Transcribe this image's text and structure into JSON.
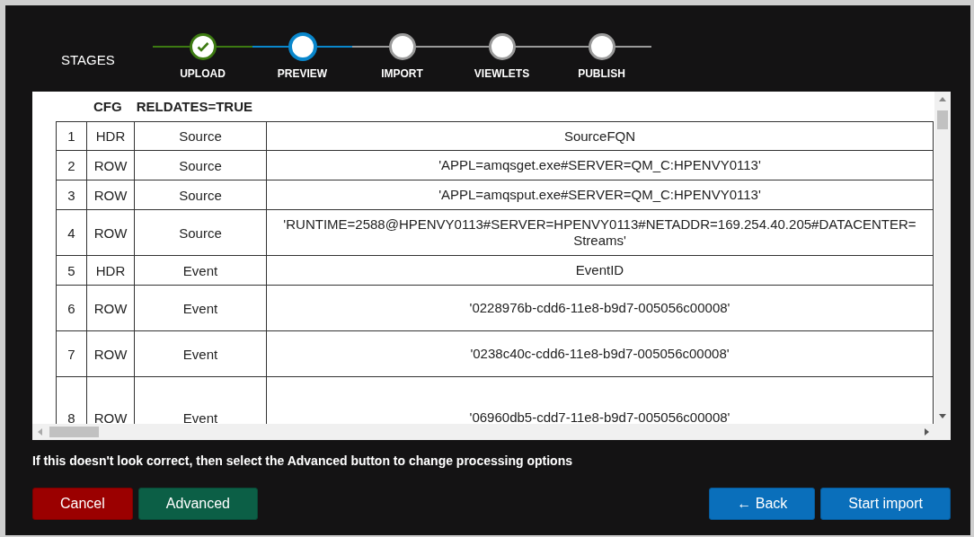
{
  "stages_label": "STAGES",
  "stages": [
    {
      "label": "UPLOAD",
      "completed": true,
      "selected": false
    },
    {
      "label": "PREVIEW",
      "completed": false,
      "selected": true
    },
    {
      "label": "IMPORT",
      "completed": false,
      "selected": false
    },
    {
      "label": "VIEWLETS",
      "completed": false,
      "selected": false
    },
    {
      "label": "PUBLISH",
      "completed": false,
      "selected": false
    }
  ],
  "config": {
    "key": "CFG",
    "value": "RELDATES=TRUE"
  },
  "table": {
    "rows": [
      {
        "cells": [
          "1",
          "HDR",
          "Source",
          [
            "SourceFQN"
          ]
        ]
      },
      {
        "cells": [
          "2",
          "ROW",
          "Source",
          [
            "'APPL=amqsget.exe#SERVER=QM_C:HPENVY0113'"
          ]
        ]
      },
      {
        "cells": [
          "3",
          "ROW",
          "Source",
          [
            "'APPL=amqsput.exe#SERVER=QM_C:HPENVY0113'"
          ]
        ]
      },
      {
        "cells": [
          "4",
          "ROW",
          "Source",
          [
            "'RUNTIME=2588@HPENVY0113#SERVER=HPENVY0113#NETADDR=169.254.40.205#DATACENTER=",
            "Streams'"
          ]
        ]
      },
      {
        "cells": [
          "5",
          "HDR",
          "Event",
          [
            "EventID"
          ]
        ]
      },
      {
        "cells": [
          "6",
          "ROW",
          "Event",
          [
            "'0228976b-cdd6-11e8-b9d7-005056c00008'"
          ]
        ]
      },
      {
        "cells": [
          "7",
          "ROW",
          "Event",
          [
            "'0238c40c-cdd6-11e8-b9d7-005056c00008'"
          ]
        ]
      },
      {
        "cells": [
          "8",
          "ROW",
          "Event",
          [
            "'06960db5-cdd7-11e8-b9d7-005056c00008'"
          ]
        ]
      }
    ]
  },
  "message": "If this doesn't look correct, then select the Advanced button to change processing options",
  "buttons_left": [
    {
      "label": "Cancel",
      "kind": "danger"
    },
    {
      "label": "Advanced",
      "kind": "secondary"
    }
  ],
  "buttons_right": [
    {
      "label": "← Back",
      "kind": "primary"
    },
    {
      "label": "Start import",
      "kind": "primary"
    }
  ]
}
